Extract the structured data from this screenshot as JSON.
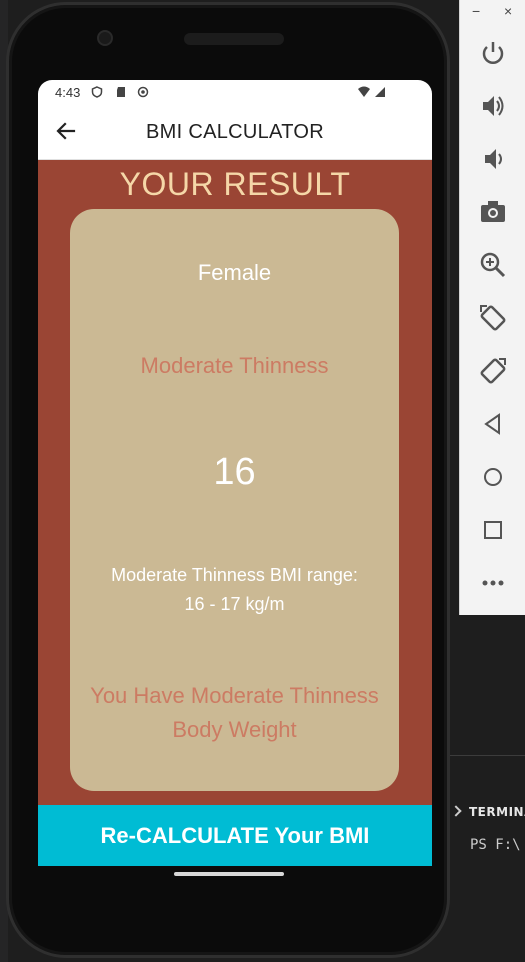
{
  "status_bar": {
    "time": "4:43"
  },
  "app_bar": {
    "title": "BMI CALCULATOR",
    "back_icon": "arrow-back-icon"
  },
  "result": {
    "heading": "YOUR RESULT",
    "gender": "Female",
    "category": "Moderate Thinness",
    "bmi_value": "16",
    "range_line1": "Moderate Thinness BMI range:",
    "range_line2": "16 - 17 kg/m",
    "advice": "You Have Moderate Thinness Body Weight"
  },
  "action": {
    "recalculate_label": "Re-CALCULATE Your BMI"
  },
  "emulator_toolbar": {
    "minimize": "−",
    "close": "×",
    "buttons": [
      "power-icon",
      "volume-up-icon",
      "volume-down-icon",
      "camera-icon",
      "zoom-icon",
      "rotate-left-icon",
      "rotate-right-icon",
      "back-icon",
      "home-icon",
      "overview-icon",
      "more-icon"
    ]
  },
  "ide": {
    "terminal_tab": "TERMINA",
    "terminal_prompt": "PS F:\\"
  },
  "colors": {
    "background": "#9a4534",
    "card": "#cbb994",
    "heading": "#f5d7a8",
    "accent_text": "#cc7b63",
    "button": "#00bcd4"
  }
}
